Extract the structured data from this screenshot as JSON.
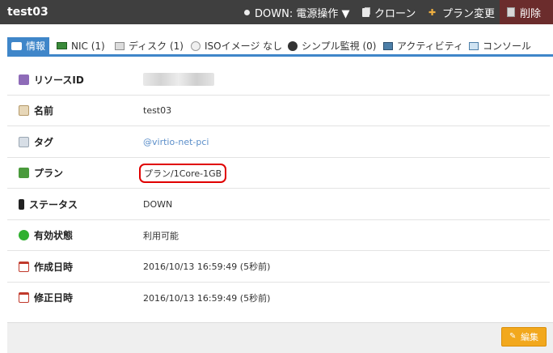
{
  "header": {
    "server_name": "test03",
    "power_menu_label": "DOWN: 電源操作 ▼",
    "clone_label": "クローン",
    "plan_change_label": "プラン変更",
    "delete_label": "削除"
  },
  "tabs": [
    {
      "label": "情報",
      "icon": "info-icon",
      "active": true
    },
    {
      "label": "NIC (1)",
      "icon": "nic-icon"
    },
    {
      "label": "ディスク (1)",
      "icon": "disk-icon"
    },
    {
      "label": "ISOイメージ なし",
      "icon": "iso-icon"
    },
    {
      "label": "シンプル監視 (0)",
      "icon": "monitor-icon"
    },
    {
      "label": "アクティビティ",
      "icon": "activity-icon"
    },
    {
      "label": "コンソール",
      "icon": "console-icon"
    }
  ],
  "details": [
    {
      "label": "リソースID",
      "value": "",
      "icon": "resource-id-icon"
    },
    {
      "label": "名前",
      "value": "test03",
      "icon": "name-icon"
    },
    {
      "label": "タグ",
      "value": "@virtio-net-pci",
      "icon": "tag-icon"
    },
    {
      "label": "プラン",
      "value": "プラン/1Core-1GB",
      "icon": "plan-icon"
    },
    {
      "label": "ステータス",
      "value": "DOWN",
      "icon": "status-icon"
    },
    {
      "label": "有効状態",
      "value": "利用可能",
      "icon": "valid-icon"
    },
    {
      "label": "作成日時",
      "value": "2016/10/13 16:59:49 (5秒前)",
      "icon": "calendar-icon"
    },
    {
      "label": "修正日時",
      "value": "2016/10/13 16:59:49 (5秒前)",
      "icon": "calendar-icon"
    }
  ],
  "footer": {
    "edit_label": "編集"
  },
  "colors": {
    "topbar": "#3f3f3f",
    "tab_active": "#3f86c9",
    "delete_bg": "#6b2c2c",
    "highlight": "#e00000",
    "edit_button": "#f2a81d"
  }
}
